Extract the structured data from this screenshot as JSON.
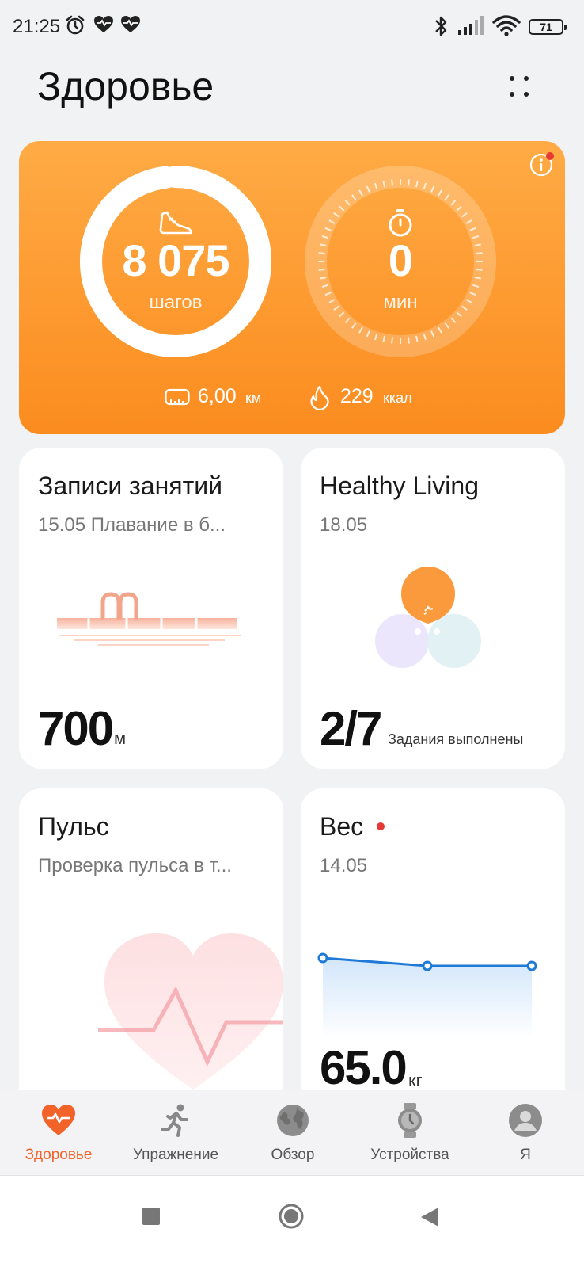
{
  "status_bar": {
    "time": "21:25",
    "battery": "71",
    "icons": [
      "alarm-icon",
      "heart-pulse-icon",
      "heart-pulse-icon",
      "bluetooth-icon",
      "signal-icon",
      "wifi-icon",
      "battery-icon"
    ]
  },
  "header": {
    "title": "Здоровье",
    "menu_icon": "more-dots-icon"
  },
  "activity": {
    "steps_value": "8 075",
    "steps_unit": "шагов",
    "steps_progress": 0.98,
    "minutes_value": "0",
    "minutes_unit": "мин",
    "distance_value": "6,00",
    "distance_unit": "км",
    "calories_value": "229",
    "calories_unit": "ккал",
    "accent_color": "#fb8c1f"
  },
  "tiles": {
    "workouts": {
      "title": "Записи занятий",
      "subtitle": "15.05 Плавание в б...",
      "value": "700",
      "unit": "м"
    },
    "healthy_living": {
      "title": "Healthy Living",
      "subtitle": "18.05",
      "value": "2/7",
      "unit": "Задания выполнены"
    },
    "pulse": {
      "title": "Пульс",
      "subtitle": "Проверка пульса в т..."
    },
    "weight": {
      "title": "Вес",
      "subtitle": "14.05",
      "value": "65.0",
      "unit": "кг"
    }
  },
  "bottom_nav": {
    "items": [
      {
        "label": "Здоровье",
        "icon": "heart-icon",
        "active": true
      },
      {
        "label": "Упражнение",
        "icon": "running-icon",
        "active": false
      },
      {
        "label": "Обзор",
        "icon": "globe-icon",
        "active": false
      },
      {
        "label": "Устройства",
        "icon": "watch-icon",
        "active": false
      },
      {
        "label": "Я",
        "icon": "profile-icon",
        "active": false
      }
    ],
    "active_color": "#f2632a"
  },
  "system_nav": {
    "buttons": [
      "recents-button",
      "home-button",
      "back-button"
    ]
  }
}
